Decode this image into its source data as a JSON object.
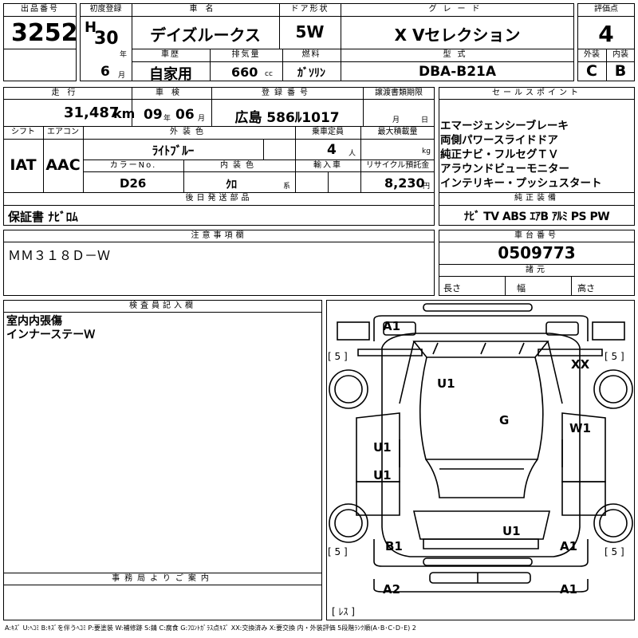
{
  "headers": {
    "lot_no": "出品番号",
    "first_reg": "初度登録",
    "car_name": "車名",
    "door": "ドア形状",
    "grade": "グレード",
    "score": "評価点",
    "history": "車歴",
    "displacement": "排気量",
    "fuel": "燃料",
    "model": "型式",
    "exterior": "外装",
    "interior": "内装",
    "mileage": "走行",
    "inspection": "車検",
    "registration": "登録番号",
    "transfer_docs": "譲渡書類期限",
    "sales_point": "セールスポイント",
    "shift": "シフト",
    "aircon": "エアコン",
    "ext_color": "外装色",
    "capacity": "乗車定員",
    "max_load": "最大積載量",
    "color_no": "カラーNo.",
    "int_color": "内装色",
    "import": "輸入車",
    "recycle": "リサイクル預託金",
    "later_parts": "後日発送部品",
    "genuine_equip": "純正装備",
    "notes": "注意事項欄",
    "chassis_no": "車台番号",
    "dimensions": "諸元",
    "inspector": "検査員記入欄",
    "office": "事務局よりご案内"
  },
  "values": {
    "lot_no": "3252",
    "era": "H",
    "year": "30",
    "year_unit": "年",
    "month": "6",
    "month_unit": "月",
    "car_name": "デイズルークス",
    "door": "5W",
    "grade": "X Vセレクション",
    "score": "4",
    "history": "自家用",
    "displacement": "660",
    "displacement_unit": "cc",
    "fuel": "ｶﾞｿﾘﾝ",
    "model": "DBA-B21A",
    "exterior": "C",
    "interior": "B",
    "mileage": "31,487",
    "mileage_unit": "km",
    "insp_year": "09",
    "insp_year_unit": "年",
    "insp_month": "06",
    "insp_month_unit": "月",
    "registration": "広島 586ﾙ1017",
    "transfer_month_unit": "月",
    "transfer_day_unit": "日",
    "shift": "IAT",
    "aircon": "AAC",
    "ext_color": "ﾗｲﾄﾌﾞﾙｰ",
    "capacity": "4",
    "capacity_unit": "人",
    "max_load_unit": "kg",
    "color_no": "D26",
    "int_color": "ｸﾛ",
    "int_color_unit": "系",
    "recycle": "8,230",
    "recycle_unit": "円",
    "later_parts": "保証書 ﾅﾋﾞﾛﾑ",
    "notes": "ＭＭ３１８Ｄ－Ｗ",
    "chassis_no": "0509773",
    "length_label": "長さ",
    "width_label": "幅",
    "height_label": "高さ"
  },
  "sales_points": [
    "エマージェンシーブレーキ",
    "両側パワースライドドア",
    "純正ナビ・フルセグＴＶ",
    "アラウンドビューモニター",
    "インテリキー・プッシュスタート"
  ],
  "equipment": "ﾅﾋﾞ TV ABS ｴｱB ｱﾙﾐ PS PW",
  "inspector_notes": [
    "室内内張傷",
    "インナーステーＷ"
  ],
  "diagram": {
    "a1_top": "A1",
    "xx": "XX",
    "u1_upper": "U1",
    "g": "G",
    "w1": "W1",
    "u1_left1": "U1",
    "u1_left2": "U1",
    "u1_lower": "U1",
    "b1": "B1",
    "a1_right": "A1",
    "a2": "A2",
    "a1_bottom": "A1",
    "tire_tl": "[ 5 ]",
    "tire_tr": "[ 5 ]",
    "tire_bl": "[ 5 ]",
    "tire_br": "[ 5 ]",
    "spare": "[ ﾚｽ ]"
  },
  "legend": "A:ｷｽﾞ U:ﾍｺﾐ B:ｷｽﾞを伴うﾍｺﾐ P:要塗装 W:補修跡 S:錆 C:腐食 G:ﾌﾛﾝﾄｶﾞﾗｽ点ｷｽﾞ XX:交換済み X:要交換 内・外装評価 5段階ﾗﾝｸ順(A･B･C･D･E) 2"
}
